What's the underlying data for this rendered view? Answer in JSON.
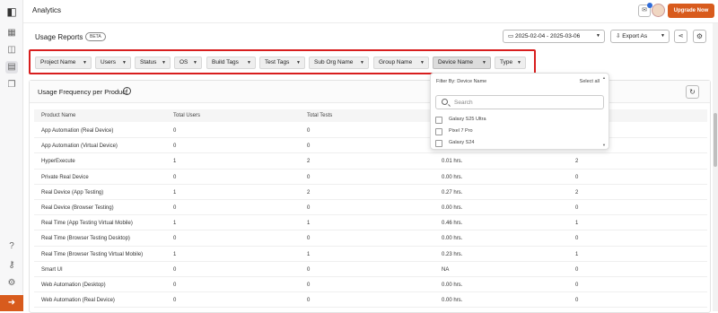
{
  "app": {
    "title": "Analytics",
    "upgrade_label": "Upgrade Now"
  },
  "page": {
    "title": "Usage Reports",
    "badge": "BETA"
  },
  "toolbar": {
    "date_range": "2025-02-04 - 2025-03-06",
    "export_label": "Export As"
  },
  "filters": [
    {
      "label": "Project Name"
    },
    {
      "label": "Users"
    },
    {
      "label": "Status"
    },
    {
      "label": "OS"
    },
    {
      "label": "Build Tags"
    },
    {
      "label": "Test Tags"
    },
    {
      "label": "Sub Org Name"
    },
    {
      "label": "Group Name"
    },
    {
      "label": "Device Name"
    },
    {
      "label": "Type"
    }
  ],
  "card": {
    "title": "Usage Frequency per Product"
  },
  "table": {
    "headers": [
      "Product Name",
      "Total Users",
      "Total Tests",
      "",
      ""
    ],
    "rows": [
      [
        "App Automation (Real Device)",
        "0",
        "0",
        "",
        ""
      ],
      [
        "App Automation (Virtual Device)",
        "0",
        "0",
        "",
        ""
      ],
      [
        "HyperExecute",
        "1",
        "2",
        "0.01 hrs.",
        "2"
      ],
      [
        "Private Real Device",
        "0",
        "0",
        "0.00 hrs.",
        "0"
      ],
      [
        "Real Device (App Testing)",
        "1",
        "2",
        "0.27 hrs.",
        "2"
      ],
      [
        "Real Device (Browser Testing)",
        "0",
        "0",
        "0.00 hrs.",
        "0"
      ],
      [
        "Real Time (App Testing Virtual Mobile)",
        "1",
        "1",
        "0.46 hrs.",
        "1"
      ],
      [
        "Real Time (Browser Testing Desktop)",
        "0",
        "0",
        "0.00 hrs.",
        "0"
      ],
      [
        "Real Time (Browser Testing Virtual Mobile)",
        "1",
        "1",
        "0.23 hrs.",
        "1"
      ],
      [
        "Smart UI",
        "0",
        "0",
        "NA",
        "0"
      ],
      [
        "Web Automation (Desktop)",
        "0",
        "0",
        "0.00 hrs.",
        "0"
      ],
      [
        "Web Automation (Real Device)",
        "0",
        "0",
        "0.00 hrs.",
        "0"
      ]
    ]
  },
  "dropdown": {
    "heading": "Filter By: Device Name",
    "select_all": "Select all",
    "search_placeholder": "Search",
    "options": [
      {
        "label": "Galaxy S25 Ultra",
        "checked": false
      },
      {
        "label": "Pixel 7 Pro",
        "checked": false
      },
      {
        "label": "Galaxy S24",
        "checked": false
      }
    ]
  },
  "colors": {
    "accent": "#d85b1d",
    "highlight_border": "#d81e1e"
  },
  "icons": [
    "logo-icon",
    "dashboard-icon",
    "reports-icon",
    "usage-icon",
    "copy-icon",
    "help-icon",
    "key-icon",
    "settings-icon",
    "exit-icon",
    "notification-icon",
    "calendar-icon",
    "share-icon",
    "gear-icon",
    "info-icon",
    "refresh-icon",
    "search-icon"
  ]
}
